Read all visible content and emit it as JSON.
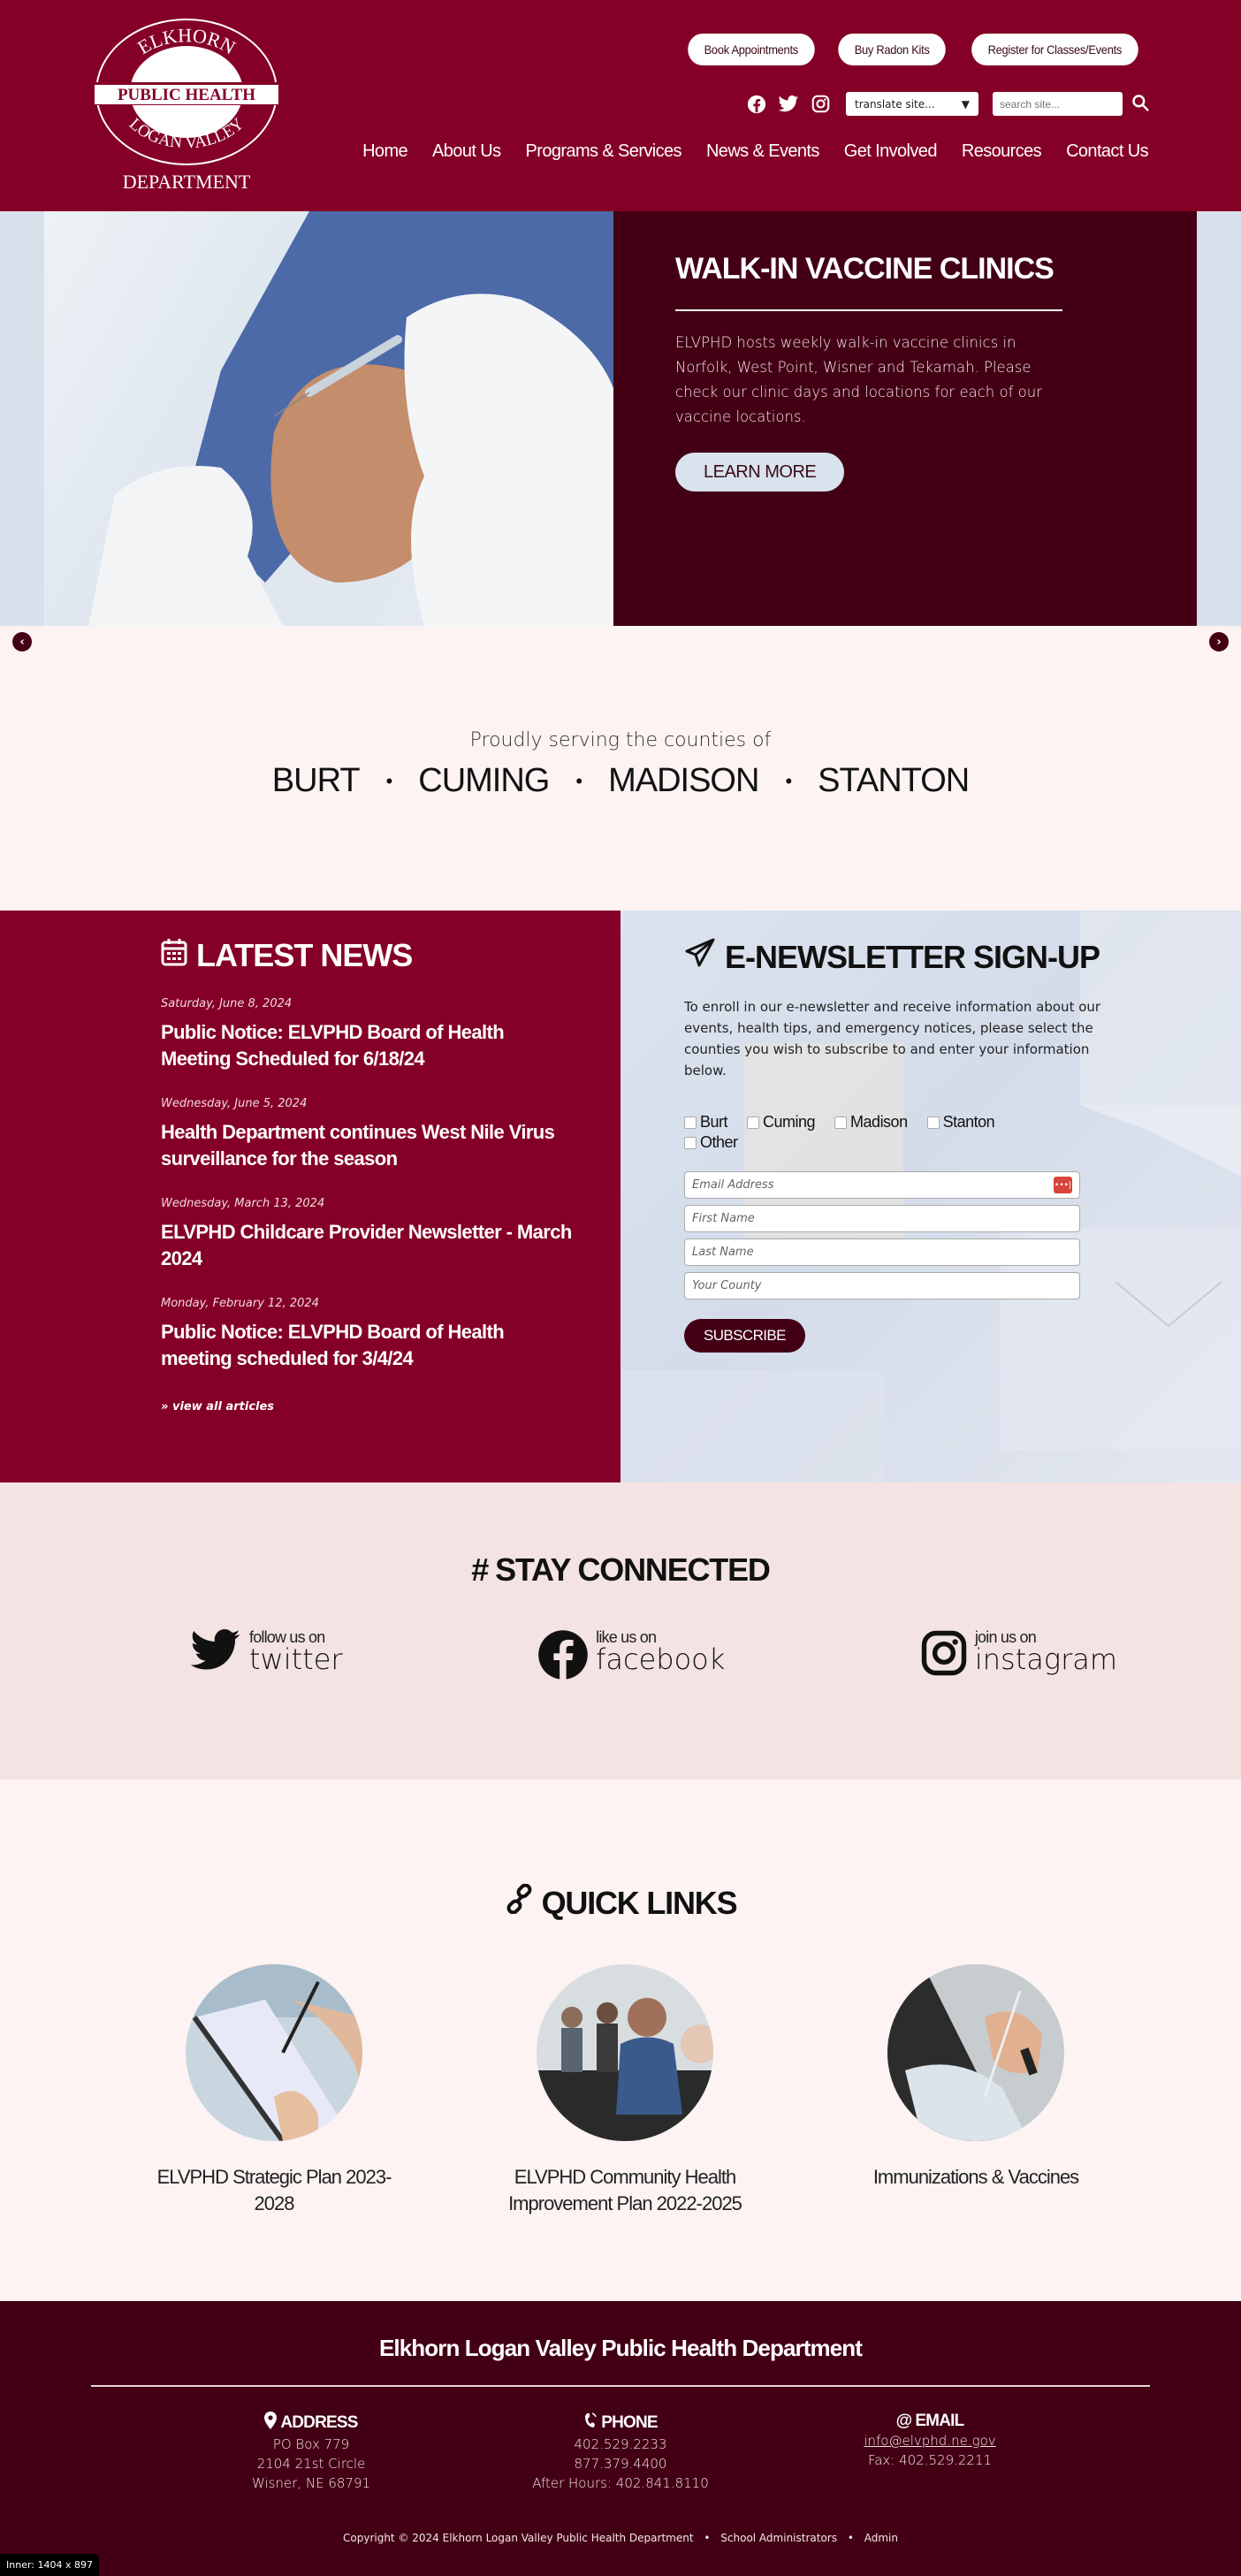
{
  "header": {
    "logo": {
      "top": "ELKHORN",
      "band": "PUBLIC HEALTH",
      "bottom": "LOGAN  VALLEY",
      "caption": "DEPARTMENT"
    },
    "top_buttons": [
      "Book Appointments",
      "Buy Radon Kits",
      "Register for Classes/Events"
    ],
    "social_icons": [
      "facebook-icon",
      "twitter-icon",
      "instagram-icon"
    ],
    "translate": {
      "value": "translate site..."
    },
    "search": {
      "placeholder": "search site..."
    },
    "nav": [
      "Home",
      "About Us",
      "Programs & Services",
      "News & Events",
      "Get Involved",
      "Resources",
      "Contact Us"
    ]
  },
  "hero": {
    "title": "WALK-IN VACCINE CLINICS",
    "text": "ELVPHD hosts weekly walk-in vaccine clinics in Norfolk, West Point, Wisner and Tekamah. Please check our clinic days and locations for each of our vaccine locations.",
    "button": "LEARN MORE",
    "prev_icon": "‹",
    "next_icon": "›"
  },
  "counties": {
    "intro": "Proudly serving the counties of",
    "list": [
      "BURT",
      "CUMING",
      "MADISON",
      "STANTON"
    ],
    "separator": "•"
  },
  "news": {
    "title": "LATEST NEWS",
    "items": [
      {
        "date": "Saturday, June 8, 2024",
        "title": "Public Notice: ELVPHD Board of Health Meeting Scheduled for 6/18/24"
      },
      {
        "date": "Wednesday, June 5, 2024",
        "title": "Health Department continues West Nile Virus surveillance for the season"
      },
      {
        "date": "Wednesday, March 13, 2024",
        "title": "ELVPHD Childcare Provider Newsletter - March 2024"
      },
      {
        "date": "Monday, February 12, 2024",
        "title": "Public Notice: ELVPHD Board of Health meeting scheduled for 3/4/24"
      }
    ],
    "view_all": "» view all articles"
  },
  "newsletter": {
    "title": "E-NEWSLETTER SIGN-UP",
    "text": "To enroll in our e-newsletter and receive information about our events, health tips, and emergency notices, please select the counties you wish to subscribe to and enter your information below.",
    "checkboxes": [
      "Burt",
      "Cuming",
      "Madison",
      "Stanton",
      "Other"
    ],
    "fields": {
      "email": "Email Address",
      "first": "First Name",
      "last": "Last Name",
      "county": "Your County"
    },
    "submit": "SUBSCRIBE"
  },
  "connect": {
    "title": "STAY CONNECTED",
    "hash": "#",
    "items": [
      {
        "small": "follow us on",
        "big": "twitter"
      },
      {
        "small": "like us on",
        "big": "facebook"
      },
      {
        "small": "join us on",
        "big": "instagram"
      }
    ]
  },
  "quick_links": {
    "title": "QUICK LINKS",
    "items": [
      "ELVPHD Strategic Plan 2023-2028",
      "ELVPHD Community Health Improvement Plan 2022-2025",
      "Immunizations & Vaccines"
    ]
  },
  "footer": {
    "title": "Elkhorn Logan Valley Public Health Department",
    "address": {
      "head": "ADDRESS",
      "lines": [
        "PO Box 779",
        "2104 21st Circle",
        "Wisner, NE 68791"
      ]
    },
    "phone": {
      "head": "PHONE",
      "lines": [
        "402.529.2233",
        "877.379.4400",
        "After Hours: 402.841.8110"
      ]
    },
    "email": {
      "head": "EMAIL",
      "link": "info@elvphd.ne.gov",
      "fax": "Fax: 402.529.2211"
    },
    "copyright": "Copyright © 2024 Elkhorn Logan Valley Public Health Department",
    "links": [
      "School Administrators",
      "Admin"
    ],
    "sep": "•"
  },
  "viewport_badge": "Inner: 1404 x 897",
  "colors": {
    "brand": "#850026",
    "dark": "#430015",
    "light_bg": "#fcf3f2",
    "connect_bg": "#f3e3e3",
    "hero_side": "#d6e1ec"
  }
}
